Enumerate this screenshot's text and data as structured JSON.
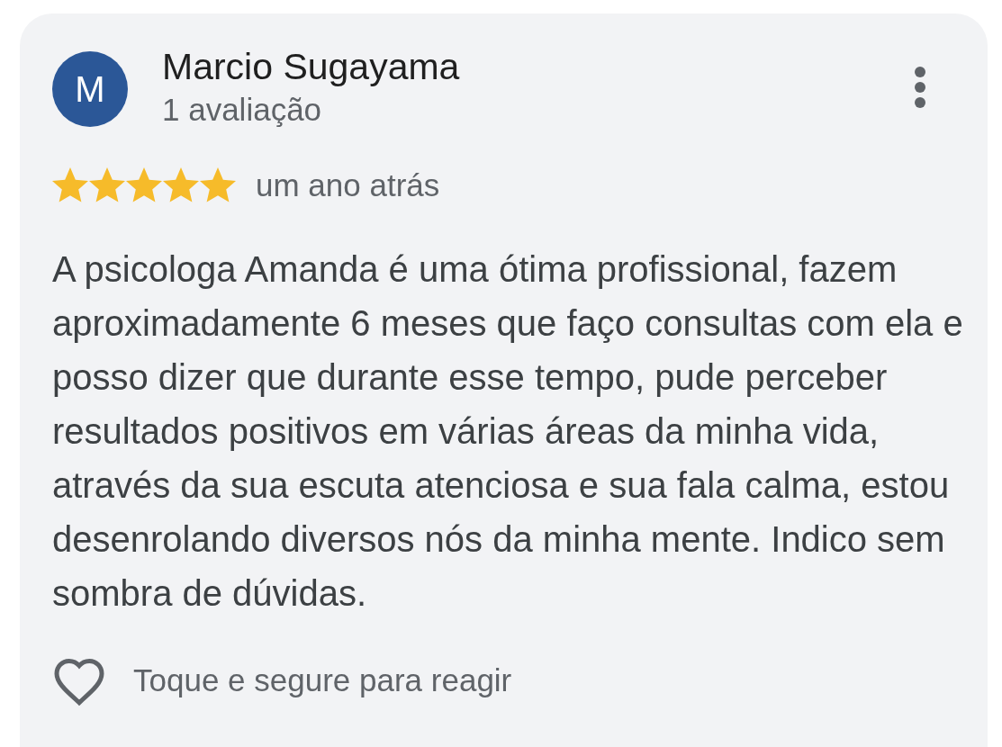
{
  "review": {
    "author": {
      "initial": "M",
      "name": "Marcio Sugayama",
      "reviews": "1 avaliação"
    },
    "stars": 5,
    "time": "um ano atrás",
    "text": "A psicologa Amanda é uma ótima profissional, fazem aproximadamente 6 meses que faço consultas com ela e posso dizer que durante esse tempo, pude perceber resultados positivos em várias áreas da minha vida, através da sua escuta atenciosa e sua fala calma, estou desenrolando diversos nós da minha mente. Indico sem sombra de dúvidas.",
    "reaction_hint": "Toque e segure para reagir"
  }
}
